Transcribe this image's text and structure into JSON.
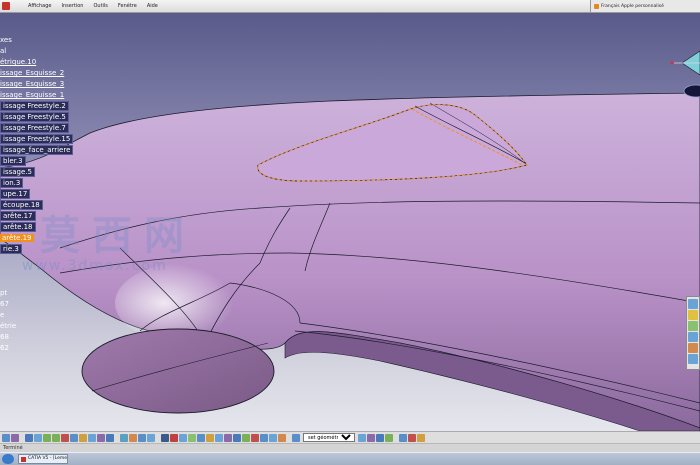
{
  "menubar": {
    "items": [
      "",
      "Affichage",
      "Insertion",
      "Outils",
      "Fenêtre",
      "Aide"
    ],
    "browser_tab": "Français Apple personnalisé"
  },
  "tree": {
    "rows": [
      {
        "label": "xes",
        "style": "plain"
      },
      {
        "label": "al",
        "style": "plain"
      },
      {
        "label": "étrique.10",
        "style": "underline"
      },
      {
        "label": "issage_Esquisse_2",
        "style": "underline"
      },
      {
        "label": "issage_Esquisse_3",
        "style": "underline"
      },
      {
        "label": "issage_Esquisse_1",
        "style": "underline"
      },
      {
        "label": "issage Freestyle.2",
        "style": "boxed"
      },
      {
        "label": "issage Freestyle.5",
        "style": "boxed"
      },
      {
        "label": "issage Freestyle.7",
        "style": "boxed"
      },
      {
        "label": "issage Freestyle.15",
        "style": "boxed"
      },
      {
        "label": "issage_face_arriere",
        "style": "boxed"
      },
      {
        "label": "bler.3",
        "style": "boxed"
      },
      {
        "label": "issage.5",
        "style": "boxed"
      },
      {
        "label": "ion.3",
        "style": "boxed"
      },
      {
        "label": "upe.17",
        "style": "boxed"
      },
      {
        "label": "écoupe.18",
        "style": "boxed"
      },
      {
        "label": "arête.17",
        "style": "boxed"
      },
      {
        "label": "arête.18",
        "style": "boxed"
      },
      {
        "label": "arête.19",
        "style": "selected"
      },
      {
        "label": "rie.3",
        "style": "boxed"
      },
      {
        "label": "",
        "style": "plain"
      },
      {
        "label": "",
        "style": "plain"
      },
      {
        "label": "",
        "style": "plain"
      },
      {
        "label": "pt",
        "style": "plain"
      },
      {
        "label": "67",
        "style": "plain"
      },
      {
        "label": "e",
        "style": "plain"
      },
      {
        "label": "étrie",
        "style": "plain"
      },
      {
        "label": "68",
        "style": "plain"
      },
      {
        "label": "62",
        "style": "plain"
      }
    ]
  },
  "watermark": {
    "cn": "莫西网",
    "url": "www.3dmox.com"
  },
  "bottom_toolbar": {
    "geo_set": "set géométrique.10"
  },
  "statusbar": {
    "text": "Terminé"
  },
  "taskbar": {
    "task": "CATIA V5 - [Lemeure_..."
  },
  "colors": {
    "background_top": "#5a5a8a",
    "background_bottom": "#e6e6ee",
    "surface": "#c4a2d2",
    "selection": "#f0901e",
    "edges": "#1b1b2a"
  }
}
